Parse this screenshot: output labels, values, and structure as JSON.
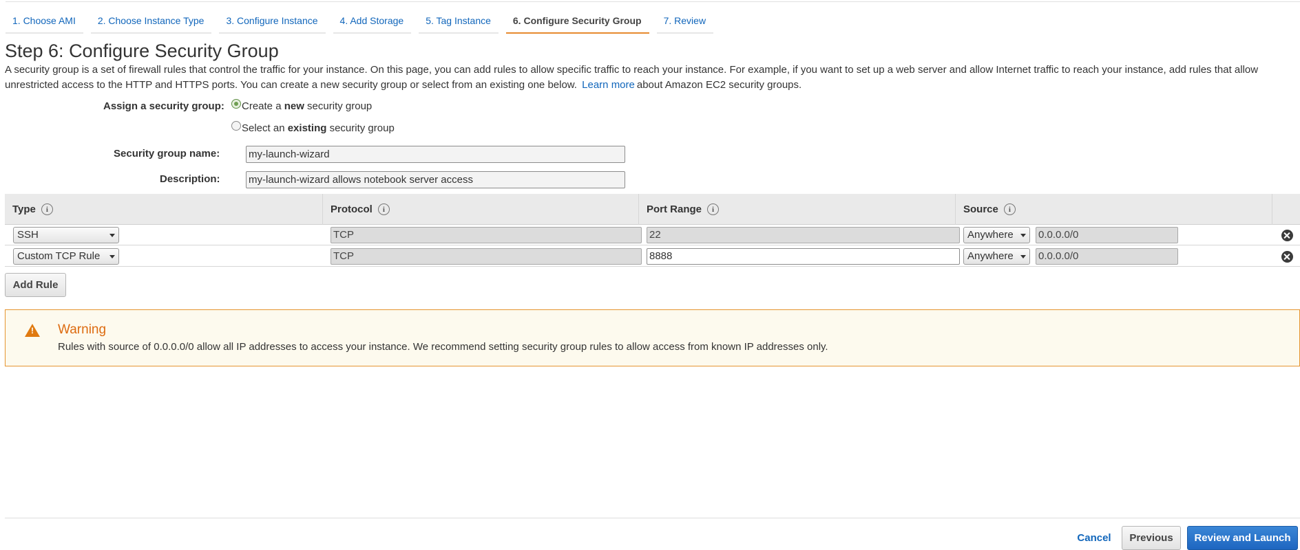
{
  "wizard": {
    "tabs": [
      {
        "label": "1. Choose AMI"
      },
      {
        "label": "2. Choose Instance Type"
      },
      {
        "label": "3. Configure Instance"
      },
      {
        "label": "4. Add Storage"
      },
      {
        "label": "5. Tag Instance"
      },
      {
        "label": "6. Configure Security Group",
        "active": true
      },
      {
        "label": "7. Review"
      }
    ]
  },
  "page": {
    "title": "Step 6: Configure Security Group",
    "intro_text": "A security group is a set of firewall rules that control the traffic for your instance. On this page, you can add rules to allow specific traffic to reach your instance. For example, if you want to set up a web server and allow Internet traffic to reach your instance, add rules that allow unrestricted access to the HTTP and HTTPS ports. You can create a new security group or select from an existing one below.",
    "learn_more": "Learn more",
    "intro_suffix": "about Amazon EC2 security groups."
  },
  "assign": {
    "label": "Assign a security group:",
    "option_new_prefix": "Create a ",
    "option_new_bold": "new",
    "option_new_suffix": " security group",
    "option_existing_prefix": "Select an ",
    "option_existing_bold": "existing",
    "option_existing_suffix": " security group",
    "selected": "new"
  },
  "group": {
    "name_label": "Security group name:",
    "name_value": "my-launch-wizard",
    "description_label": "Description:",
    "description_value": "my-launch-wizard allows notebook server access"
  },
  "rules": {
    "headers": {
      "type": "Type",
      "protocol": "Protocol",
      "port_range": "Port Range",
      "source": "Source"
    },
    "info_glyph": "i",
    "rows": [
      {
        "type": "SSH",
        "protocol": "TCP",
        "port_range": "22",
        "source": "Anywhere",
        "cidr": "0.0.0.0/0"
      },
      {
        "type": "Custom TCP Rule",
        "protocol": "TCP",
        "port_range": "8888",
        "source": "Anywhere",
        "cidr": "0.0.0.0/0"
      }
    ],
    "add_rule_label": "Add Rule"
  },
  "warning": {
    "title": "Warning",
    "text": "Rules with source of 0.0.0.0/0 allow all IP addresses to access your instance. We recommend setting security group rules to allow access from known IP addresses only.",
    "icon_glyph": "!"
  },
  "footer": {
    "cancel": "Cancel",
    "previous": "Previous",
    "review_launch": "Review and Launch"
  },
  "colors": {
    "link": "#1166bb",
    "active_tab_underline": "#e68a2e",
    "warning_accent": "#dd6b10",
    "primary_button": "#1e66c0"
  }
}
